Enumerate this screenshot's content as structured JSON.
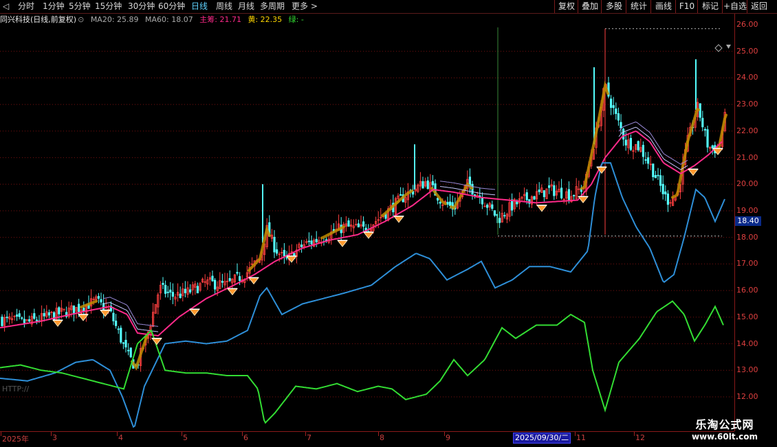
{
  "toolbar": {
    "timeframes": [
      "分时",
      "1分钟",
      "5分钟",
      "15分钟",
      "30分钟",
      "60分钟",
      "日线",
      "周线",
      "月线",
      "多周期",
      "更多 >"
    ],
    "active_timeframe": "日线",
    "right_buttons": [
      "复权",
      "叠加",
      "多股",
      "统计",
      "画线",
      "F10",
      "标记",
      "+自选",
      "返回"
    ]
  },
  "info": {
    "title": "同兴科技(日线,前复权)",
    "title_icon": "circle-dropdown-icon",
    "ma20": "MA20: 25.89",
    "ma60": "MA60: 18.07",
    "main": "主筹: 21.71",
    "yellow": "黄: 22.35",
    "green": "绿: -"
  },
  "yaxis": {
    "labels": [
      "26.00",
      "25.00",
      "24.00",
      "23.00",
      "22.00",
      "21.00",
      "20.00",
      "19.00",
      "18.00",
      "17.00",
      "16.00",
      "15.00",
      "14.00",
      "13.00",
      "12.00"
    ],
    "current_price": "18.40"
  },
  "xaxis": {
    "labels": [
      "2025年",
      "3",
      "4",
      "5",
      "6",
      "7",
      "8",
      "9",
      "11",
      "12"
    ],
    "cursor_date": "2025/09/30/二"
  },
  "watermark": {
    "line1": "乐淘公式网",
    "line2": "www.60lt.com"
  },
  "http_label": "HTTP://",
  "colors": {
    "up": "#ff4040",
    "down": "#54ffff",
    "ma_main": "#ff2a8a",
    "blue_line": "#2e8fd8",
    "green_line": "#33dd33",
    "candle_band": "#c08000",
    "axis": "#e04040"
  },
  "chart_data": {
    "type": "line",
    "ylim": [
      11.6,
      26.2
    ],
    "high_marker": 25.85,
    "low_marker": 18.05,
    "series": [
      {
        "name": "MA20",
        "values": []
      },
      {
        "name": "MA60",
        "values": []
      }
    ]
  }
}
